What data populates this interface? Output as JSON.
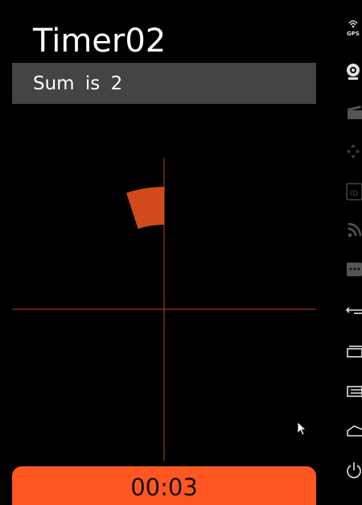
{
  "app": {
    "title": "Timer02"
  },
  "sum_bar": {
    "text": "Sum is 2"
  },
  "timer": {
    "label": "00:03",
    "elapsed_seconds": 3
  },
  "sector_display": {
    "filled_fraction": 0.05,
    "sweep_start_deg": 0,
    "sweep_direction": "counter-clockwise",
    "colors": {
      "sector": "#d04a1b",
      "axis": "#c0452a"
    }
  },
  "side_rail": {
    "gps_label": "GPS",
    "id_label": "ID",
    "icons": [
      "gps-icon",
      "webcam-icon",
      "camera-clapper-icon",
      "dpad-icon",
      "id-icon",
      "rss-icon",
      "more-icon",
      "back-icon",
      "home-icon",
      "menu-icon",
      "rotate-icon",
      "power-icon"
    ]
  },
  "colors": {
    "background": "#000000",
    "sum_bar": "#444444",
    "timer_button": "#ff5722",
    "text_light": "#ffffff",
    "text_dark": "#111111",
    "rail_icon": "#d0d0d0"
  }
}
